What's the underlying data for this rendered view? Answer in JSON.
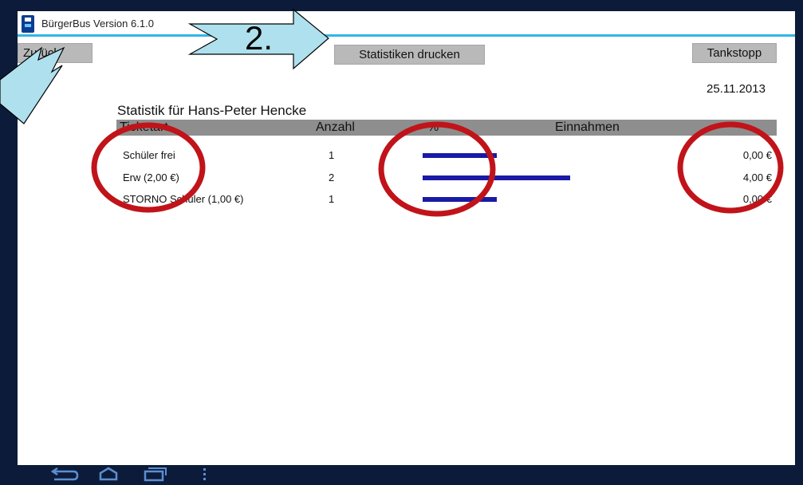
{
  "app": {
    "title": "BürgerBus Version 6.1.0"
  },
  "toolbar": {
    "back_label": "Zurück",
    "print_label": "Statistiken drucken",
    "tankstopp_label": "Tankstopp"
  },
  "date": "25.11.2013",
  "statistics": {
    "title": "Statistik für Hans-Peter Hencke",
    "columns": {
      "ticketart": "Ticketart",
      "anzahl": "Anzahl",
      "percent": "%",
      "einnahmen": "Einnahmen"
    },
    "rows": [
      {
        "type": "Schüler frei",
        "count": "1",
        "share_percent": 25,
        "revenue": "0,00 €"
      },
      {
        "type": "Erw (2,00 €)",
        "count": "2",
        "share_percent": 50,
        "revenue": "4,00 €"
      },
      {
        "type": "STORNO Schüler (1,00 €)",
        "count": "1",
        "share_percent": 25,
        "revenue": "0,00 €"
      }
    ],
    "bar_color": "#1a1aa6"
  },
  "annotation": {
    "step_label": "2.",
    "arrow_color": "#aee0ee",
    "circle_color": "#c0141a"
  },
  "navbar": {
    "icons": [
      "back-icon",
      "home-icon",
      "recent-apps-icon",
      "menu-icon"
    ]
  },
  "colors": {
    "accent": "#33b5e5",
    "frame": "#0d1b3a",
    "button": "#b9b9b9",
    "header": "#8e8e8e"
  }
}
